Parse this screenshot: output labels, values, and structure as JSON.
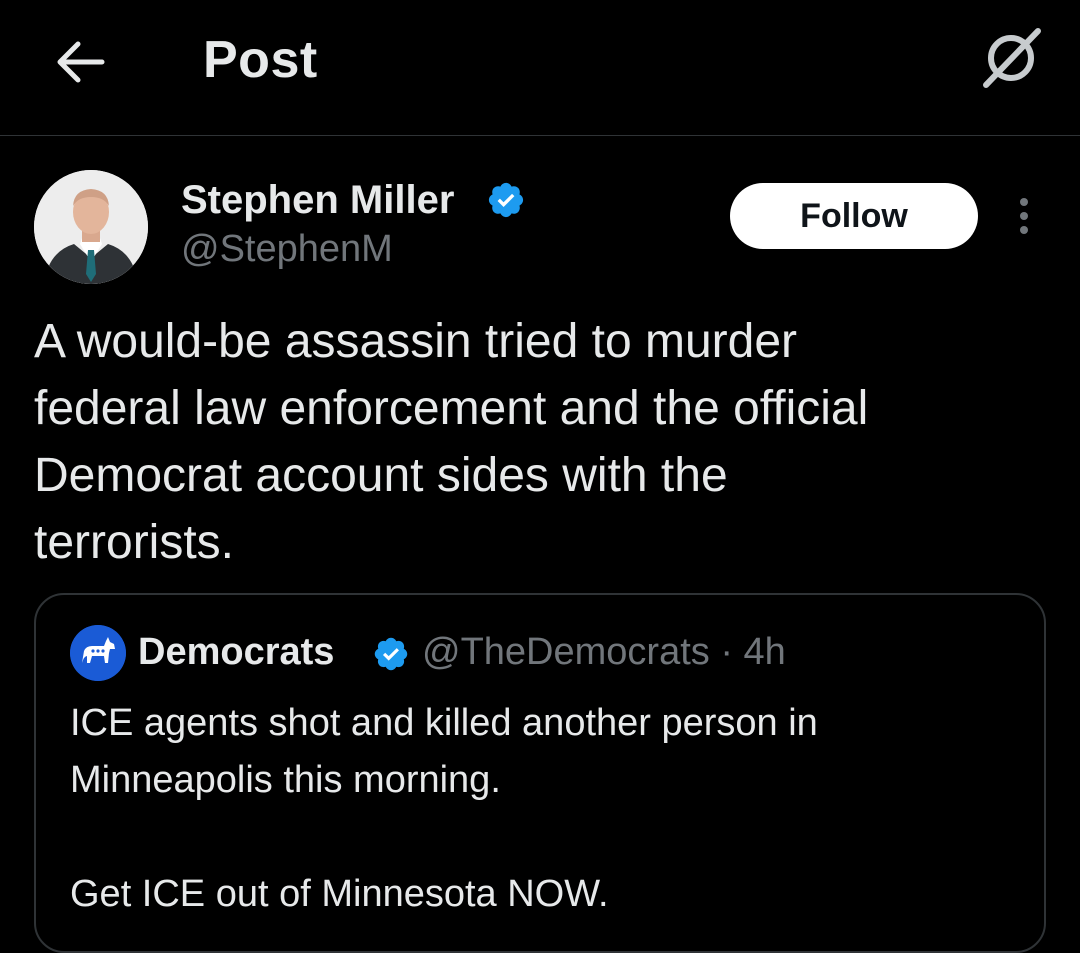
{
  "header": {
    "title": "Post",
    "back_icon": "arrow-left-icon",
    "grok_icon": "grok-icon"
  },
  "post": {
    "author": {
      "name": "Stephen Miller",
      "handle": "@StephenM",
      "verified": true
    },
    "follow_label": "Follow",
    "more_icon": "more-vertical-icon",
    "text": "A would-be assassin tried to murder\nfederal law enforcement and the official\nDemocrat account sides with the\nterrorists."
  },
  "quote": {
    "author": {
      "name": "Democrats",
      "handle": "@TheDemocrats",
      "verified": true
    },
    "meta": "@TheDemocrats · 4h",
    "text": "ICE agents shot and killed another person in\nMinneapolis this morning.\n\nGet ICE out of Minnesota NOW."
  },
  "colors": {
    "background": "#000000",
    "text_primary": "#e7e9ea",
    "text_secondary": "#71767b",
    "verified_blue": "#1d9bf0",
    "border": "#2f3336",
    "democrats_blue": "#1a5bd6"
  }
}
